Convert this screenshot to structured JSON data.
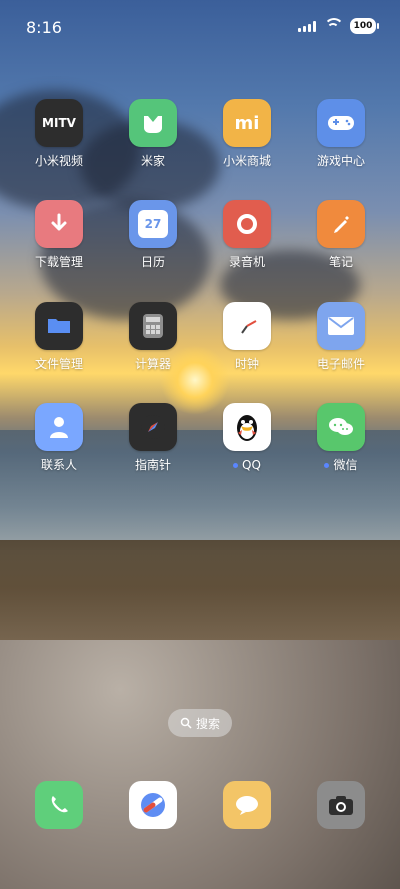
{
  "status_bar": {
    "time": "8:16",
    "battery": "100",
    "icons": [
      "signal-icon",
      "wifi-icon",
      "battery-icon"
    ]
  },
  "apps": [
    {
      "name": "小米视频",
      "icon": "mitv-icon",
      "badge": "MITV",
      "color": "#2d2d2d"
    },
    {
      "name": "米家",
      "icon": "mijia-icon",
      "color": "#55c57a"
    },
    {
      "name": "小米商城",
      "icon": "xiaomi-store-icon",
      "badge": "mi",
      "color": "#f2b447"
    },
    {
      "name": "游戏中心",
      "icon": "game-controller-icon",
      "color": "#5e8fe8"
    },
    {
      "name": "下载管理",
      "icon": "download-icon",
      "color": "#e87a7f"
    },
    {
      "name": "日历",
      "icon": "calendar-icon",
      "badge": "27",
      "color": "#6a96ea"
    },
    {
      "name": "录音机",
      "icon": "recorder-icon",
      "color": "#e15d4e"
    },
    {
      "name": "笔记",
      "icon": "notes-icon",
      "color": "#f08a3d"
    },
    {
      "name": "文件管理",
      "icon": "folder-icon",
      "color": "#2d2d2d"
    },
    {
      "name": "计算器",
      "icon": "calculator-icon",
      "color": "#2d2d2d"
    },
    {
      "name": "时钟",
      "icon": "clock-icon",
      "color": "#ffffff"
    },
    {
      "name": "电子邮件",
      "icon": "mail-icon",
      "color": "#7ea5ee"
    },
    {
      "name": "联系人",
      "icon": "contacts-icon",
      "color": "#7aa7ff"
    },
    {
      "name": "指南针",
      "icon": "compass-icon",
      "color": "#2d2d2d"
    },
    {
      "name": "QQ",
      "icon": "qq-penguin-icon",
      "color": "#ffffff",
      "has_dot": true
    },
    {
      "name": "微信",
      "icon": "wechat-icon",
      "color": "#58c76c",
      "has_dot": true
    }
  ],
  "search_button": {
    "label": "搜索",
    "icon": "search-icon"
  },
  "dock": [
    {
      "icon": "phone-icon",
      "color": "#5fcf7b"
    },
    {
      "icon": "browser-icon",
      "color": "#ffffff"
    },
    {
      "icon": "messages-icon",
      "color": "#f3c567"
    },
    {
      "icon": "camera-icon",
      "color": "#8c8c8c"
    }
  ]
}
